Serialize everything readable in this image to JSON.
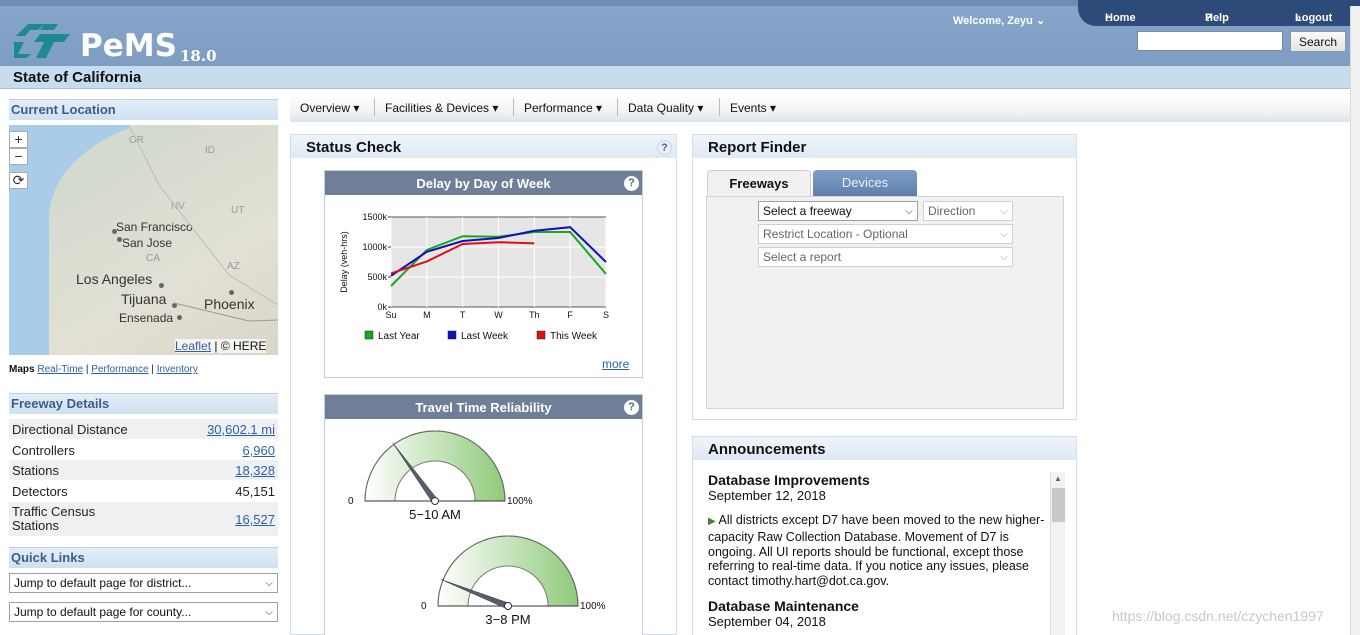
{
  "header": {
    "brand": "PeMS",
    "version": "18.0",
    "welcome": "Welcome, Zeyu",
    "nav": {
      "home": "Home",
      "help": "Help",
      "logout": "Logout"
    },
    "search_button": "Search",
    "search_value": ""
  },
  "state_title": "State of California",
  "menu": [
    "Overview",
    "Facilities & Devices",
    "Performance",
    "Data Quality",
    "Events"
  ],
  "sidebar": {
    "current_location_title": "Current Location",
    "map": {
      "cities": [
        "San Francisco",
        "San Jose",
        "Los Angeles",
        "Tijuana",
        "Ensenada",
        "Phoenix"
      ],
      "states": [
        "OR",
        "ID",
        "NV",
        "UT",
        "CA",
        "AZ"
      ],
      "attribution_link": "Leaflet",
      "attribution_sep": "|",
      "attribution_text": "© HERE",
      "zoom_in": "+",
      "zoom_out": "−"
    },
    "maps_links": {
      "label": "Maps",
      "items": [
        "Real-Time",
        "Performance",
        "Inventory"
      ],
      "sep": "|"
    },
    "freeway_details_title": "Freeway Details",
    "freeway_details": [
      {
        "label": "Directional Distance",
        "value": "30,602.1 mi"
      },
      {
        "label": "Controllers",
        "value": "6,960"
      },
      {
        "label": "Stations",
        "value": "18,328"
      },
      {
        "label": "Detectors",
        "value": "45,151"
      },
      {
        "label": "Traffic Census Stations",
        "value": "16,527"
      }
    ],
    "quick_links_title": "Quick Links",
    "quick_links": [
      "Jump to default page for district...",
      "Jump to default page for county..."
    ]
  },
  "status_check": {
    "title": "Status Check",
    "help": "?",
    "delay_card": {
      "title": "Delay by Day of Week",
      "more": "more"
    },
    "ttr_card": {
      "title": "Travel Time Reliability",
      "gauges": [
        {
          "label": "5−10 AM",
          "min": "0",
          "max": "100%",
          "value": 0.3
        },
        {
          "label": "3−8 PM",
          "min": "0",
          "max": "100%",
          "value": 0.12
        }
      ]
    }
  },
  "chart_data": {
    "type": "line",
    "categories": [
      "Su",
      "M",
      "T",
      "W",
      "Th",
      "F",
      "S"
    ],
    "ylabel": "Delay (veh-hrs)",
    "yticks": [
      "0k",
      "500k",
      "1000k",
      "1500k"
    ],
    "ylim": [
      0,
      1500
    ],
    "series": [
      {
        "name": "Last Year",
        "color": "#1aa81a",
        "values": [
          350,
          950,
          1180,
          1170,
          1250,
          1250,
          550
        ]
      },
      {
        "name": "Last Week",
        "color": "#1010c0",
        "values": [
          520,
          920,
          1100,
          1150,
          1270,
          1330,
          750
        ]
      },
      {
        "name": "This Week",
        "color": "#e01010",
        "values": [
          560,
          760,
          1050,
          1080,
          1060,
          null,
          null
        ]
      }
    ]
  },
  "report_finder": {
    "title": "Report Finder",
    "tabs": [
      "Freeways",
      "Devices"
    ],
    "selects": {
      "freeway": "Select a freeway",
      "direction": "Direction",
      "location": "Restrict Location - Optional",
      "report": "Select a report"
    }
  },
  "announcements": {
    "title": "Announcements",
    "items": [
      {
        "heading": "Database Improvements",
        "date": "September 12, 2018",
        "body": "All districts except D7 have been moved to the new higher-capacity Raw Collection Database. Movement of D7 is ongoing. All UI reports should be functional, except those referring to real-time data. If you notice any issues, please contact timothy.hart@dot.ca.gov."
      },
      {
        "heading": "Database Maintenance",
        "date": "September 04, 2018"
      }
    ]
  },
  "watermark": "https://blog.csdn.net/czychen1997"
}
